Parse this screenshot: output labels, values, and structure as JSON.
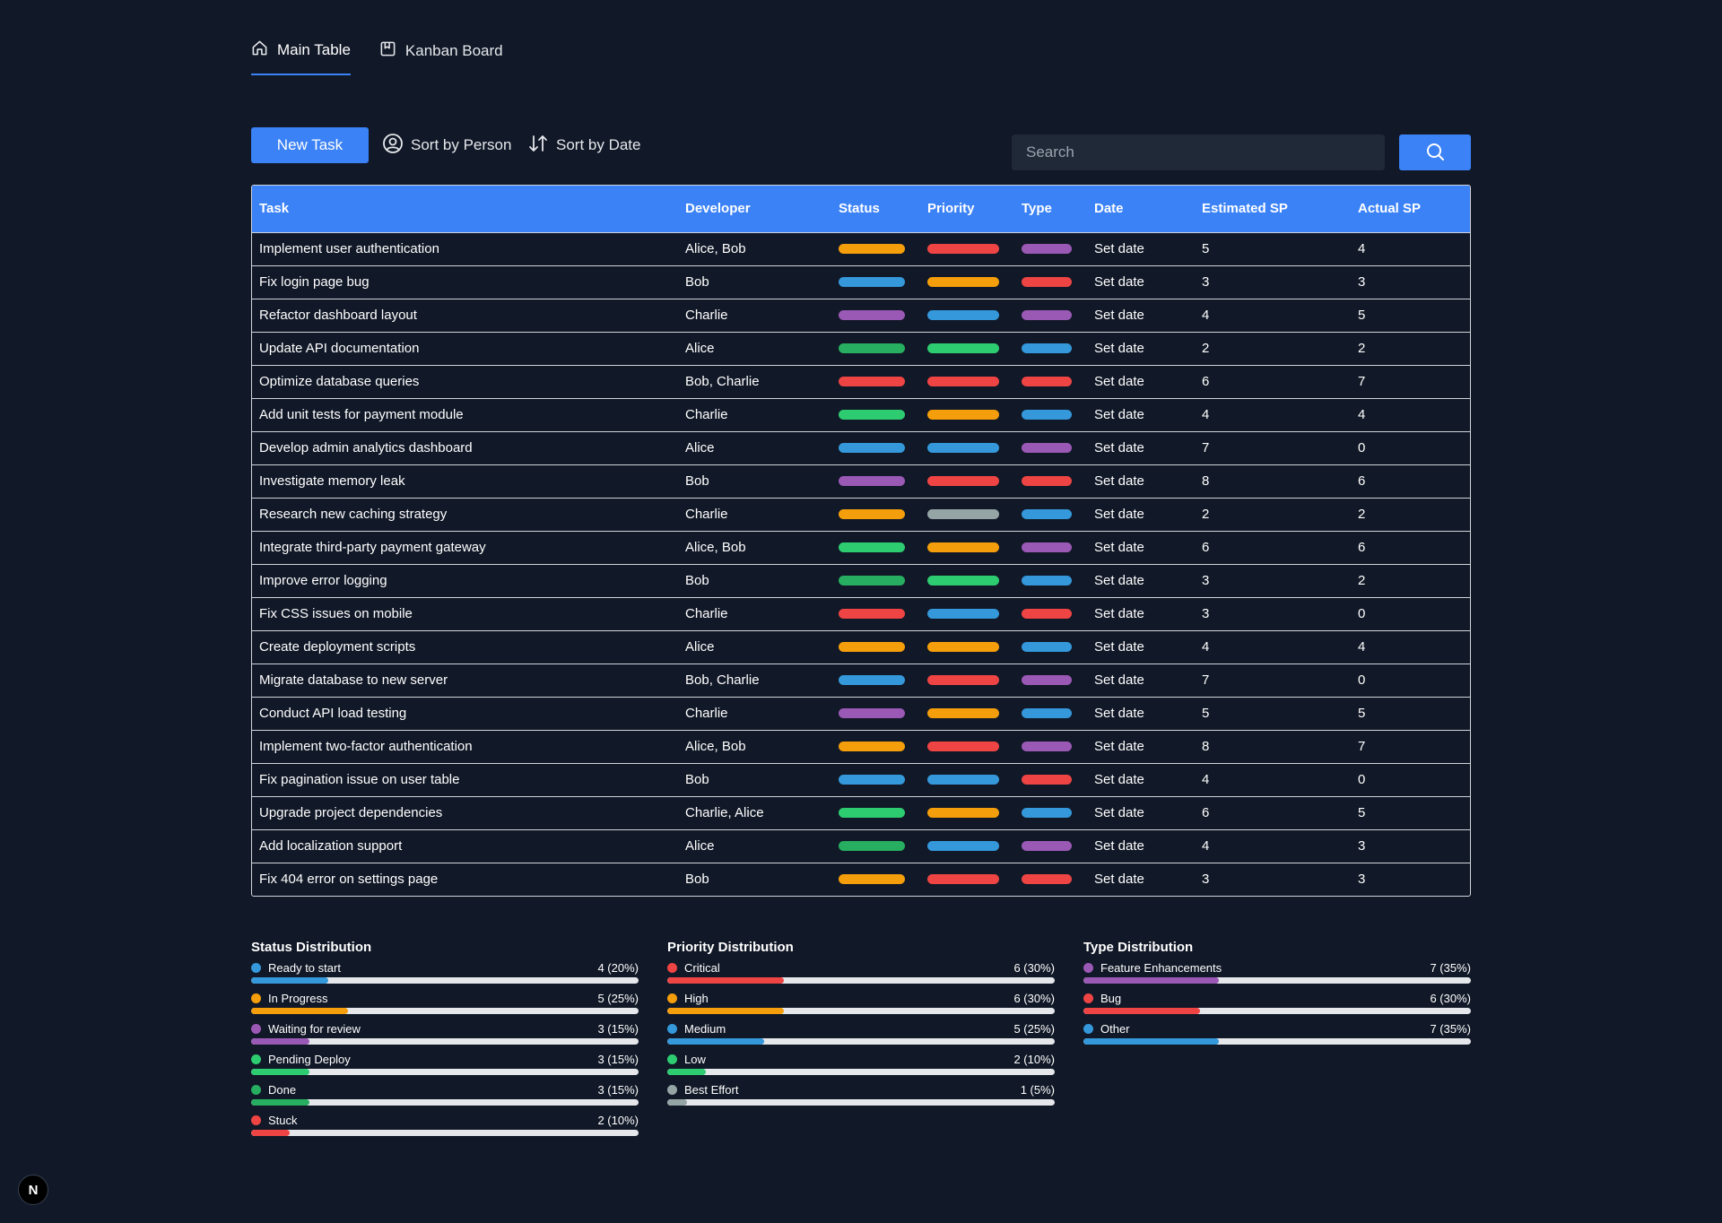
{
  "tabs": [
    {
      "label": "Main Table",
      "icon": "home-icon",
      "active": true
    },
    {
      "label": "Kanban Board",
      "icon": "board-icon",
      "active": false
    }
  ],
  "toolbar": {
    "new_task_label": "New Task",
    "sort_person_label": "Sort by Person",
    "sort_date_label": "Sort by Date",
    "search_placeholder": "Search"
  },
  "colors": {
    "accent": "#3b82f6",
    "orange": "#f59e0b",
    "red": "#ef4444",
    "purple": "#9b59b6",
    "blue": "#3498db",
    "green": "#2ecc71",
    "darkgreen": "#27ae60",
    "gray": "#95a5a6"
  },
  "table": {
    "headers": [
      "Task",
      "Developer",
      "Status",
      "Priority",
      "Type",
      "Date",
      "Estimated SP",
      "Actual SP"
    ],
    "rows": [
      {
        "task": "Implement user authentication",
        "developer": "Alice, Bob",
        "status": "orange",
        "priority": "red",
        "type": "purple",
        "date": "Set date",
        "est": "5",
        "act": "4"
      },
      {
        "task": "Fix login page bug",
        "developer": "Bob",
        "status": "blue",
        "priority": "orange",
        "type": "red",
        "date": "Set date",
        "est": "3",
        "act": "3"
      },
      {
        "task": "Refactor dashboard layout",
        "developer": "Charlie",
        "status": "purple",
        "priority": "blue",
        "type": "purple",
        "date": "Set date",
        "est": "4",
        "act": "5"
      },
      {
        "task": "Update API documentation",
        "developer": "Alice",
        "status": "darkgreen",
        "priority": "green",
        "type": "blue",
        "date": "Set date",
        "est": "2",
        "act": "2"
      },
      {
        "task": "Optimize database queries",
        "developer": "Bob, Charlie",
        "status": "red",
        "priority": "red",
        "type": "red",
        "date": "Set date",
        "est": "6",
        "act": "7"
      },
      {
        "task": "Add unit tests for payment module",
        "developer": "Charlie",
        "status": "green",
        "priority": "orange",
        "type": "blue",
        "date": "Set date",
        "est": "4",
        "act": "4"
      },
      {
        "task": "Develop admin analytics dashboard",
        "developer": "Alice",
        "status": "blue",
        "priority": "blue",
        "type": "purple",
        "date": "Set date",
        "est": "7",
        "act": "0"
      },
      {
        "task": "Investigate memory leak",
        "developer": "Bob",
        "status": "purple",
        "priority": "red",
        "type": "red",
        "date": "Set date",
        "est": "8",
        "act": "6"
      },
      {
        "task": "Research new caching strategy",
        "developer": "Charlie",
        "status": "orange",
        "priority": "gray",
        "type": "blue",
        "date": "Set date",
        "est": "2",
        "act": "2"
      },
      {
        "task": "Integrate third-party payment gateway",
        "developer": "Alice, Bob",
        "status": "green",
        "priority": "orange",
        "type": "purple",
        "date": "Set date",
        "est": "6",
        "act": "6"
      },
      {
        "task": "Improve error logging",
        "developer": "Bob",
        "status": "darkgreen",
        "priority": "green",
        "type": "blue",
        "date": "Set date",
        "est": "3",
        "act": "2"
      },
      {
        "task": "Fix CSS issues on mobile",
        "developer": "Charlie",
        "status": "red",
        "priority": "blue",
        "type": "red",
        "date": "Set date",
        "est": "3",
        "act": "0"
      },
      {
        "task": "Create deployment scripts",
        "developer": "Alice",
        "status": "orange",
        "priority": "orange",
        "type": "blue",
        "date": "Set date",
        "est": "4",
        "act": "4"
      },
      {
        "task": "Migrate database to new server",
        "developer": "Bob, Charlie",
        "status": "blue",
        "priority": "red",
        "type": "purple",
        "date": "Set date",
        "est": "7",
        "act": "0"
      },
      {
        "task": "Conduct API load testing",
        "developer": "Charlie",
        "status": "purple",
        "priority": "orange",
        "type": "blue",
        "date": "Set date",
        "est": "5",
        "act": "5"
      },
      {
        "task": "Implement two-factor authentication",
        "developer": "Alice, Bob",
        "status": "orange",
        "priority": "red",
        "type": "purple",
        "date": "Set date",
        "est": "8",
        "act": "7"
      },
      {
        "task": "Fix pagination issue on user table",
        "developer": "Bob",
        "status": "blue",
        "priority": "blue",
        "type": "red",
        "date": "Set date",
        "est": "4",
        "act": "0"
      },
      {
        "task": "Upgrade project dependencies",
        "developer": "Charlie, Alice",
        "status": "green",
        "priority": "orange",
        "type": "blue",
        "date": "Set date",
        "est": "6",
        "act": "5"
      },
      {
        "task": "Add localization support",
        "developer": "Alice",
        "status": "darkgreen",
        "priority": "blue",
        "type": "purple",
        "date": "Set date",
        "est": "4",
        "act": "3"
      },
      {
        "task": "Fix 404 error on settings page",
        "developer": "Bob",
        "status": "orange",
        "priority": "red",
        "type": "red",
        "date": "Set date",
        "est": "3",
        "act": "3"
      }
    ]
  },
  "distributions": [
    {
      "title": "Status Distribution",
      "items": [
        {
          "label": "Ready to start",
          "value": "4 (20%)",
          "pct": 20,
          "color": "blue"
        },
        {
          "label": "In Progress",
          "value": "5 (25%)",
          "pct": 25,
          "color": "orange"
        },
        {
          "label": "Waiting for review",
          "value": "3 (15%)",
          "pct": 15,
          "color": "purple"
        },
        {
          "label": "Pending Deploy",
          "value": "3 (15%)",
          "pct": 15,
          "color": "green"
        },
        {
          "label": "Done",
          "value": "3 (15%)",
          "pct": 15,
          "color": "darkgreen"
        },
        {
          "label": "Stuck",
          "value": "2 (10%)",
          "pct": 10,
          "color": "red"
        }
      ]
    },
    {
      "title": "Priority Distribution",
      "items": [
        {
          "label": "Critical",
          "value": "6 (30%)",
          "pct": 30,
          "color": "red"
        },
        {
          "label": "High",
          "value": "6 (30%)",
          "pct": 30,
          "color": "orange"
        },
        {
          "label": "Medium",
          "value": "5 (25%)",
          "pct": 25,
          "color": "blue"
        },
        {
          "label": "Low",
          "value": "2 (10%)",
          "pct": 10,
          "color": "green"
        },
        {
          "label": "Best Effort",
          "value": "1 (5%)",
          "pct": 5,
          "color": "gray"
        }
      ]
    },
    {
      "title": "Type Distribution",
      "items": [
        {
          "label": "Feature Enhancements",
          "value": "7 (35%)",
          "pct": 35,
          "color": "purple"
        },
        {
          "label": "Bug",
          "value": "6 (30%)",
          "pct": 30,
          "color": "red"
        },
        {
          "label": "Other",
          "value": "7 (35%)",
          "pct": 35,
          "color": "blue"
        }
      ]
    }
  ],
  "badge": "N"
}
